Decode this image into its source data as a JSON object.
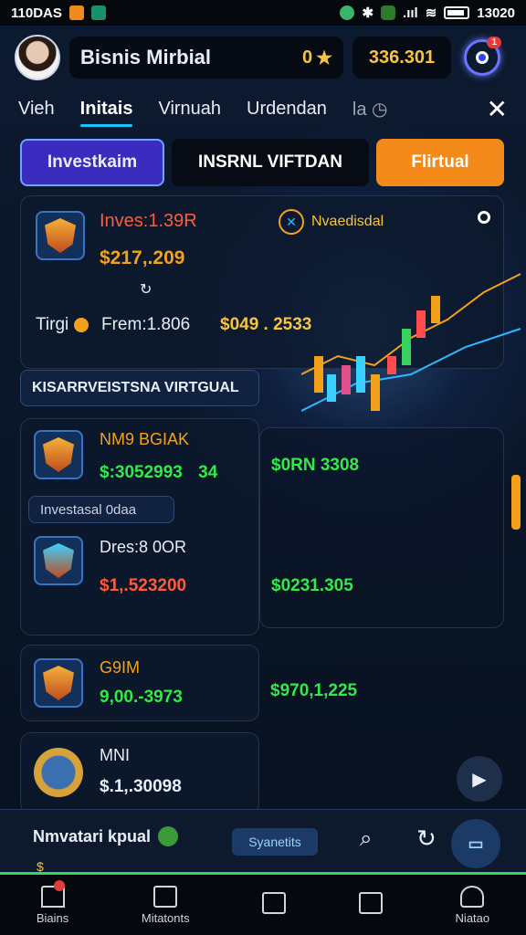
{
  "status": {
    "time_left": "110DAS",
    "time_right": "13020",
    "signal": ".ııl"
  },
  "header": {
    "title": "Bisnis Mirbial",
    "count": "0",
    "balance": "336.301",
    "notif_badge": "1"
  },
  "tabs": [
    {
      "label": "Vieh"
    },
    {
      "label": "Initais"
    },
    {
      "label": "Virnuah"
    },
    {
      "label": "Urdendan"
    },
    {
      "label": "la"
    }
  ],
  "categories": [
    "Investkaim",
    "INSRNL VIFTDAN",
    "Flirtual"
  ],
  "hero": {
    "title": "Inves:1.39R",
    "value": "$217,.209",
    "tag_label": "Tirgi",
    "from_label": "Frem:1.806",
    "mid_value": "$049 . 2533",
    "right_title": "Nvaedisdal"
  },
  "section_label": "KISARRVEISTSNA VIRTGUAL",
  "cards": [
    {
      "title": "NM9 BGIAK",
      "value": "$:3052993",
      "value2": "34",
      "right": "$0RN 3308"
    },
    {
      "title": "Dres:8 0OR",
      "value": "$1,.523200",
      "right": "$0231.305"
    },
    {
      "title": "G9IM",
      "value": "9,00.-3973",
      "right": "$970,1,225"
    },
    {
      "title": "MNI",
      "value": "$.1,.30098"
    }
  ],
  "invest_pill": "Investasal 0daa",
  "bottombar": {
    "label": "Nmvatari kpual",
    "chip": "Syanetits",
    "peek": "$"
  },
  "nav": [
    {
      "label": "Biains",
      "icon": "home-icon"
    },
    {
      "label": "Mitatonts",
      "icon": "list-icon"
    },
    {
      "label": "",
      "icon": "upload-icon"
    },
    {
      "label": "",
      "icon": "book-icon"
    },
    {
      "label": "Niatao",
      "icon": "profile-icon"
    }
  ],
  "colors": {
    "accent": "#19c3ff",
    "orange": "#f38a1a",
    "green": "#35e84a",
    "gold": "#f6c343"
  }
}
